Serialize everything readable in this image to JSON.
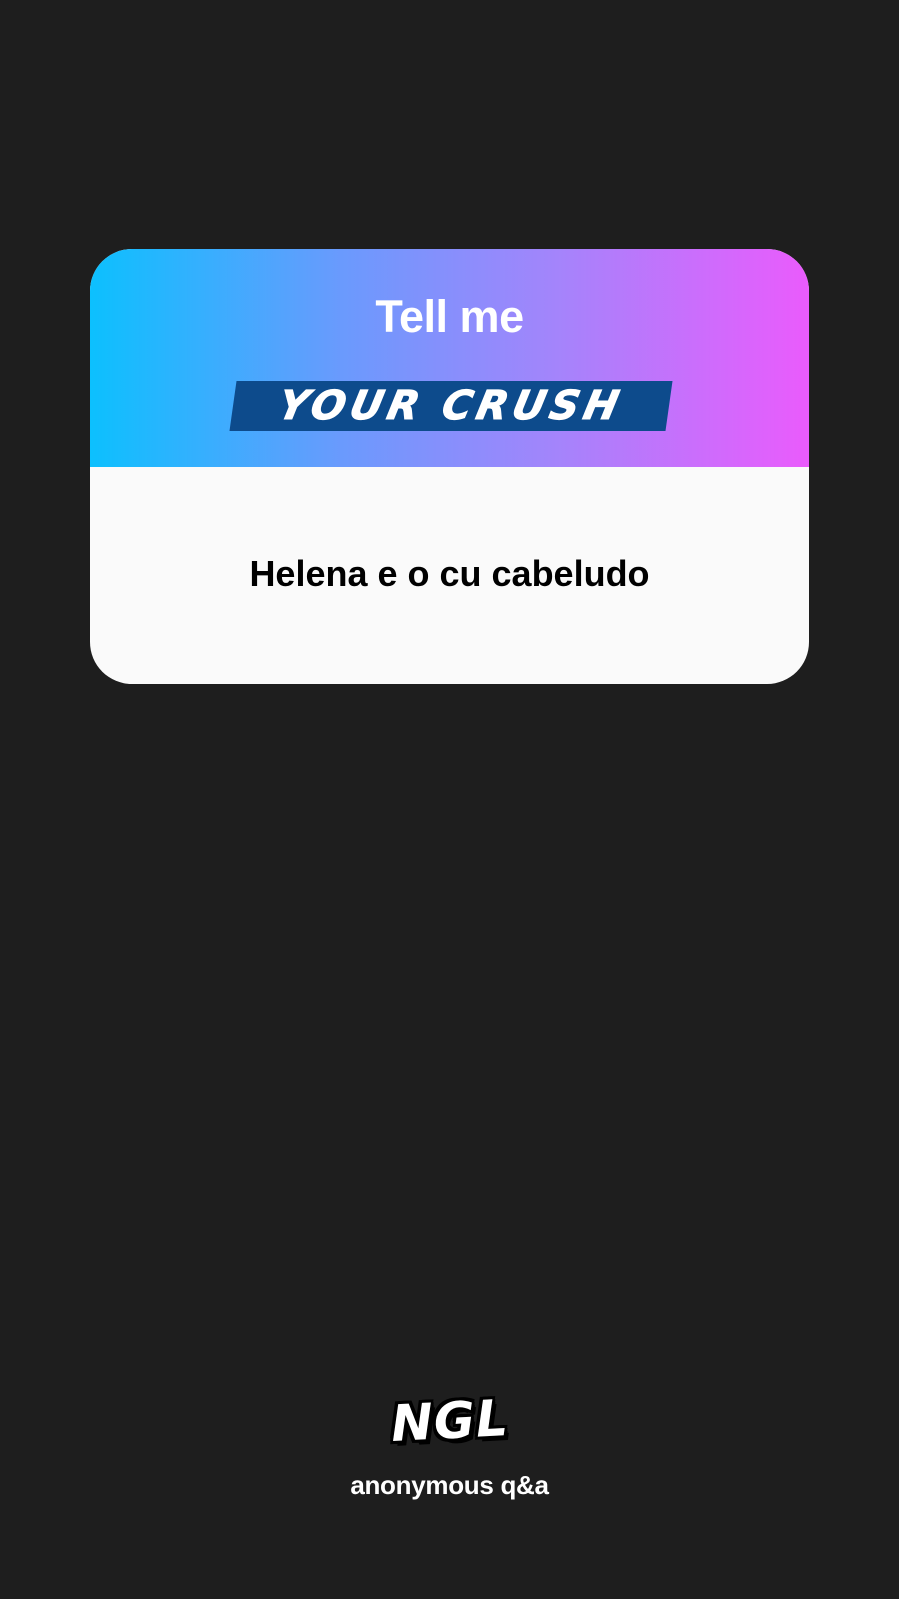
{
  "card": {
    "title": "Tell me",
    "badge": "YOUR CRUSH",
    "answer": "Helena e o cu cabeludo"
  },
  "brand": {
    "logo": "NGL",
    "tagline": "anonymous q&a"
  },
  "colors": {
    "background": "#1e1e1e",
    "gradient_start": "#0cc0fe",
    "gradient_end": "#ea5bfc",
    "badge": "#0d4b8c",
    "card_body": "#fafafa"
  }
}
